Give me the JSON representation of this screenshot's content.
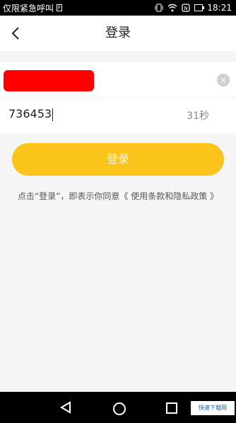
{
  "status_bar": {
    "carrier": "仅限紧急呼叫",
    "sim_icon": "sim-icon",
    "signal_icons": [
      "vibrate-icon",
      "wifi-icon",
      "nfc-icon",
      "battery-icon"
    ],
    "time": "18:21"
  },
  "header": {
    "back_icon": "chevron-left-icon",
    "title": "登录"
  },
  "form": {
    "phone_field": {
      "value_redacted": true
    },
    "clear_icon": "clear-icon",
    "clear_symbol": "×",
    "code_field": {
      "value": "736453"
    },
    "countdown": "31秒"
  },
  "login_button": {
    "label": "登录"
  },
  "agreement": {
    "text": "点击“登录”，即表示你同意《 使用条款和隐私政策 》"
  },
  "nav_bar": {
    "back_icon": "triangle-back-icon",
    "home_icon": "circle-home-icon",
    "recent_icon": "square-recents-icon"
  },
  "watermark": {
    "text": "快速下载网"
  },
  "colors": {
    "accent": "#fbc41b",
    "redaction": "#ff0000",
    "background": "#f5f5f5"
  }
}
